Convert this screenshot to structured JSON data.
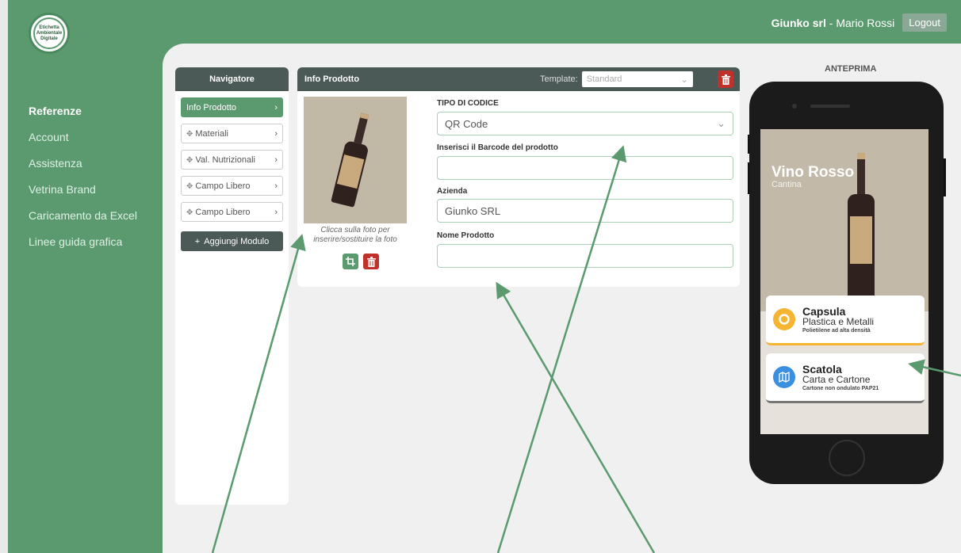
{
  "logo": {
    "lines": [
      "Etichetta",
      "Ambientale",
      "Digitale"
    ]
  },
  "sidebar": {
    "items": [
      {
        "label": "Referenze",
        "active": true
      },
      {
        "label": "Account"
      },
      {
        "label": "Assistenza"
      },
      {
        "label": "Vetrina Brand"
      },
      {
        "label": "Caricamento da Excel"
      },
      {
        "label": "Linee guida grafica"
      }
    ]
  },
  "header": {
    "company": "Giunko srl",
    "separator": " - ",
    "user": "Mario Rossi",
    "logout_label": "Logout"
  },
  "navigator": {
    "title": "Navigatore",
    "items": [
      {
        "label": "Info Prodotto",
        "active": true
      },
      {
        "label": "Materiali"
      },
      {
        "label": "Val. Nutrizionali"
      },
      {
        "label": "Campo Libero"
      },
      {
        "label": "Campo Libero"
      }
    ],
    "add_label": "Aggiungi Modulo"
  },
  "info": {
    "title": "Info Prodotto",
    "template_label": "Template:",
    "template_value": "Standard",
    "photo_note": "Clicca sulla foto per inserire/sostituire la foto",
    "fields": {
      "code_type_label": "TIPO DI CODICE",
      "code_type_value": "QR Code",
      "barcode_label": "Inserisci il Barcode del prodotto",
      "barcode_value": "",
      "company_label": "Azienda",
      "company_value": "Giunko SRL",
      "product_label": "Nome Prodotto",
      "product_value": ""
    }
  },
  "preview": {
    "title": "ANTEPRIMA",
    "product_name": "Vino Rosso",
    "subtitle": "Cantina",
    "cards": [
      {
        "title": "Capsula",
        "material": "Plastica e Metalli",
        "detail": "Polietilene ad alta densità",
        "color": "#f5b533"
      },
      {
        "title": "Scatola",
        "material": "Carta e Cartone",
        "detail": "Cartone non ondulato PAP21",
        "color": "#3b8fe0"
      }
    ]
  },
  "colors": {
    "brand_green": "#5a9a6e",
    "dark_header": "#4c5a57",
    "delete_red": "#c0312b"
  }
}
